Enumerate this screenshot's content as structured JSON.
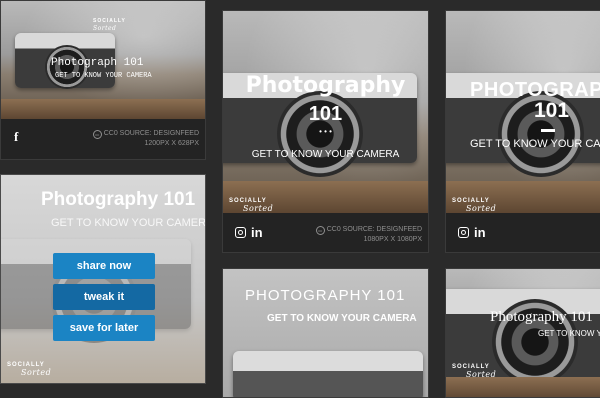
{
  "cards": [
    {
      "id": "card1",
      "title": "Photograph 101",
      "subtitle": "GET TO KNOW YOUR CAMERA",
      "social": [
        "f"
      ],
      "source_line1": "CC0 SOURCE: DESIGNFEED",
      "source_line2": "1200PX X 628PX"
    },
    {
      "id": "card2",
      "title_line1": "Photography",
      "title_line2": "101",
      "dots": "• • •",
      "subtitle": "GET TO KNOW YOUR CAMERA",
      "social": [
        "in"
      ],
      "source_line1": "CC0 SOURCE: DESIGNFEED",
      "source_line2": "1080PX X 1080PX"
    },
    {
      "id": "card3",
      "title_line1": "PHOTOGRAPHY",
      "title_line2": "101",
      "subtitle": "GET TO KNOW YOUR CAMERA",
      "social": [
        "in"
      ]
    },
    {
      "id": "card4",
      "title": "Photography 101",
      "subtitle": "GET TO KNOW YOUR CAMERA"
    },
    {
      "id": "card5",
      "title": "PHOTOGRAPHY  101",
      "subtitle": "GET TO KNOW YOUR CAMERA"
    },
    {
      "id": "card6",
      "title": "Photography 101",
      "subtitle": "GET TO KNOW YOUR CAMERA"
    }
  ],
  "brand": {
    "line1": "SOCIALLY",
    "line2": "Sorted"
  },
  "hover_actions": {
    "share": "share now",
    "tweak": "tweak it",
    "save": "save for later"
  }
}
